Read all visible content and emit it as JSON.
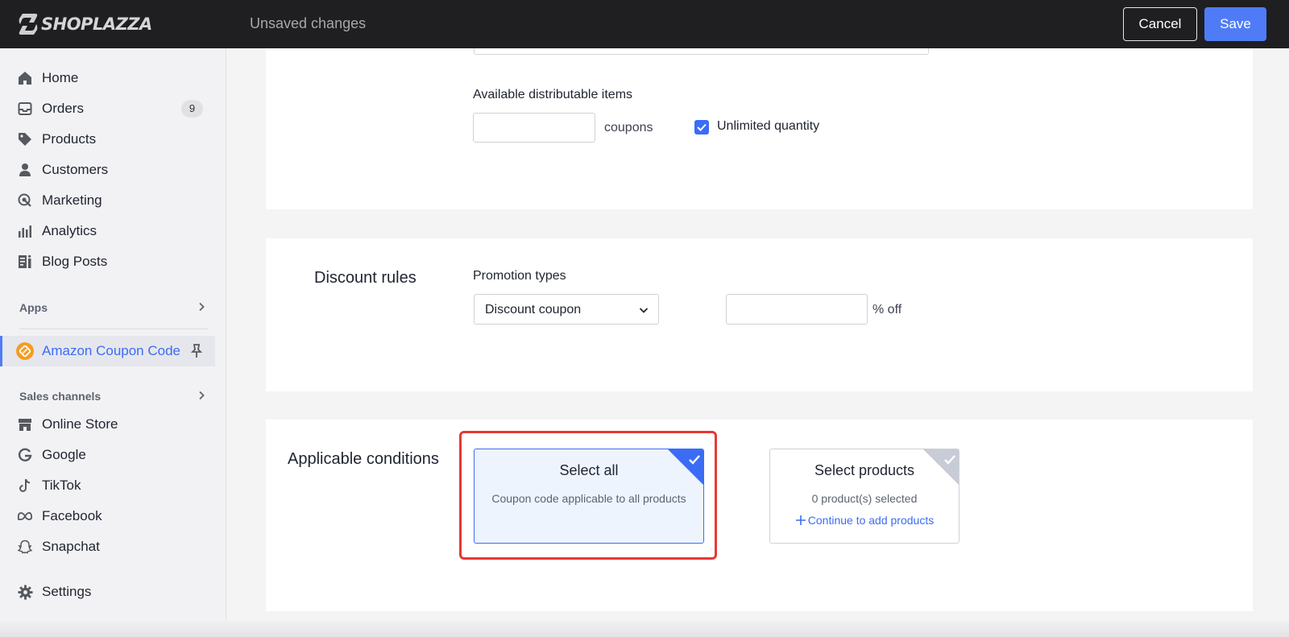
{
  "topbar": {
    "logo_text": "SHOPLAZZA",
    "status": "Unsaved changes",
    "cancel_label": "Cancel",
    "save_label": "Save",
    "save_color": "#4f7cf6"
  },
  "sidebar": {
    "items": [
      {
        "label": "Home",
        "icon": "home-icon"
      },
      {
        "label": "Orders",
        "icon": "inbox-icon",
        "badge": "9"
      },
      {
        "label": "Products",
        "icon": "tag-icon"
      },
      {
        "label": "Customers",
        "icon": "person-icon"
      },
      {
        "label": "Marketing",
        "icon": "marketing-icon"
      },
      {
        "label": "Analytics",
        "icon": "bar-chart-icon"
      },
      {
        "label": "Blog Posts",
        "icon": "blog-icon"
      }
    ],
    "apps_label": "Apps",
    "active_app": {
      "label": "Amazon Coupon Code",
      "icon": "coupon-app-icon",
      "color": "#f59d21"
    },
    "sales_channels_label": "Sales channels",
    "channels": [
      {
        "label": "Online Store",
        "icon": "store-icon"
      },
      {
        "label": "Google",
        "icon": "google-icon"
      },
      {
        "label": "TikTok",
        "icon": "tiktok-icon"
      },
      {
        "label": "Facebook",
        "icon": "meta-icon"
      },
      {
        "label": "Snapchat",
        "icon": "snapchat-icon"
      }
    ],
    "settings_label": "Settings"
  },
  "distribution": {
    "label": "Available distributable items",
    "quantity_value": "",
    "suffix": "coupons",
    "unlimited_label": "Unlimited quantity",
    "unlimited_checked": true
  },
  "discount_rules": {
    "title": "Discount rules",
    "promotion_label": "Promotion types",
    "promotion_value": "Discount coupon",
    "percent_value": "",
    "percent_suffix": "% off"
  },
  "applicable_conditions": {
    "title": "Applicable conditions",
    "options": [
      {
        "title": "Select all",
        "description": "Coupon code applicable to all products",
        "selected": true
      },
      {
        "title": "Select products",
        "description": "0 product(s) selected",
        "link": "Continue to add products",
        "selected": false
      }
    ],
    "highlight_color": "#e53935"
  }
}
